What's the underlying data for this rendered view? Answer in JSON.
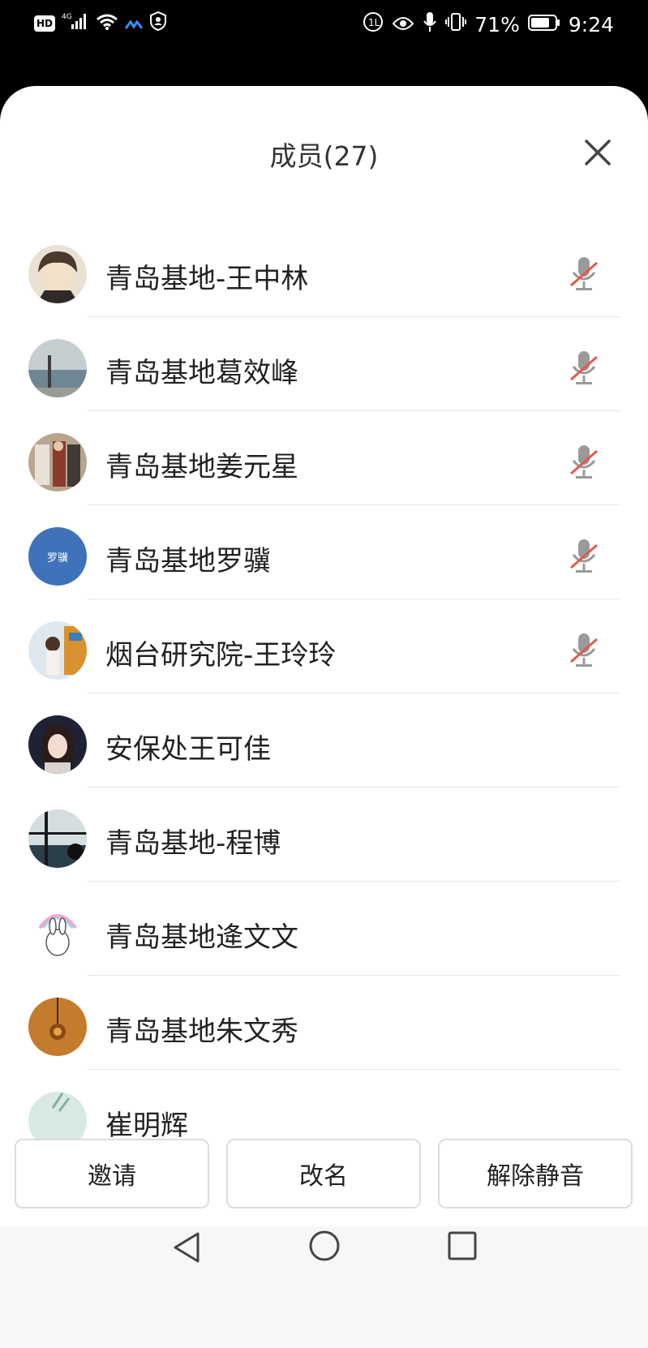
{
  "status_bar": {
    "hd": "HD",
    "signal": "4G",
    "battery": "71%",
    "time": "9:24"
  },
  "sheet": {
    "title": "成员(27)"
  },
  "members": [
    {
      "name": "青岛基地-王中林",
      "muted": true,
      "avatar_color": "#8a6a4e",
      "avatar_text": ""
    },
    {
      "name": "青岛基地葛效峰",
      "muted": true,
      "avatar_color": "#9aa7ad",
      "avatar_text": ""
    },
    {
      "name": "青岛基地姜元星",
      "muted": true,
      "avatar_color": "#7d6452",
      "avatar_text": ""
    },
    {
      "name": "青岛基地罗骥",
      "muted": true,
      "avatar_color": "#3f72b8",
      "avatar_text": "罗骥"
    },
    {
      "name": "烟台研究院-王玲玲",
      "muted": true,
      "avatar_color": "#c9a27a",
      "avatar_text": ""
    },
    {
      "name": "安保处王可佳",
      "muted": false,
      "avatar_color": "#1f2433",
      "avatar_text": ""
    },
    {
      "name": "青岛基地-程博",
      "muted": false,
      "avatar_color": "#5f7b8c",
      "avatar_text": ""
    },
    {
      "name": "青岛基地逄文文",
      "muted": false,
      "avatar_color": "#f4eef4",
      "avatar_text": ""
    },
    {
      "name": "青岛基地朱文秀",
      "muted": false,
      "avatar_color": "#c27c2c",
      "avatar_text": ""
    },
    {
      "name": "崔明辉",
      "muted": false,
      "avatar_color": "#d9e9e4",
      "avatar_text": ""
    }
  ],
  "actions": {
    "invite": "邀请",
    "rename": "改名",
    "unmute": "解除静音"
  },
  "colors": {
    "muted_slash": "#e05a4a",
    "mic_gray": "#9a9a9a"
  }
}
